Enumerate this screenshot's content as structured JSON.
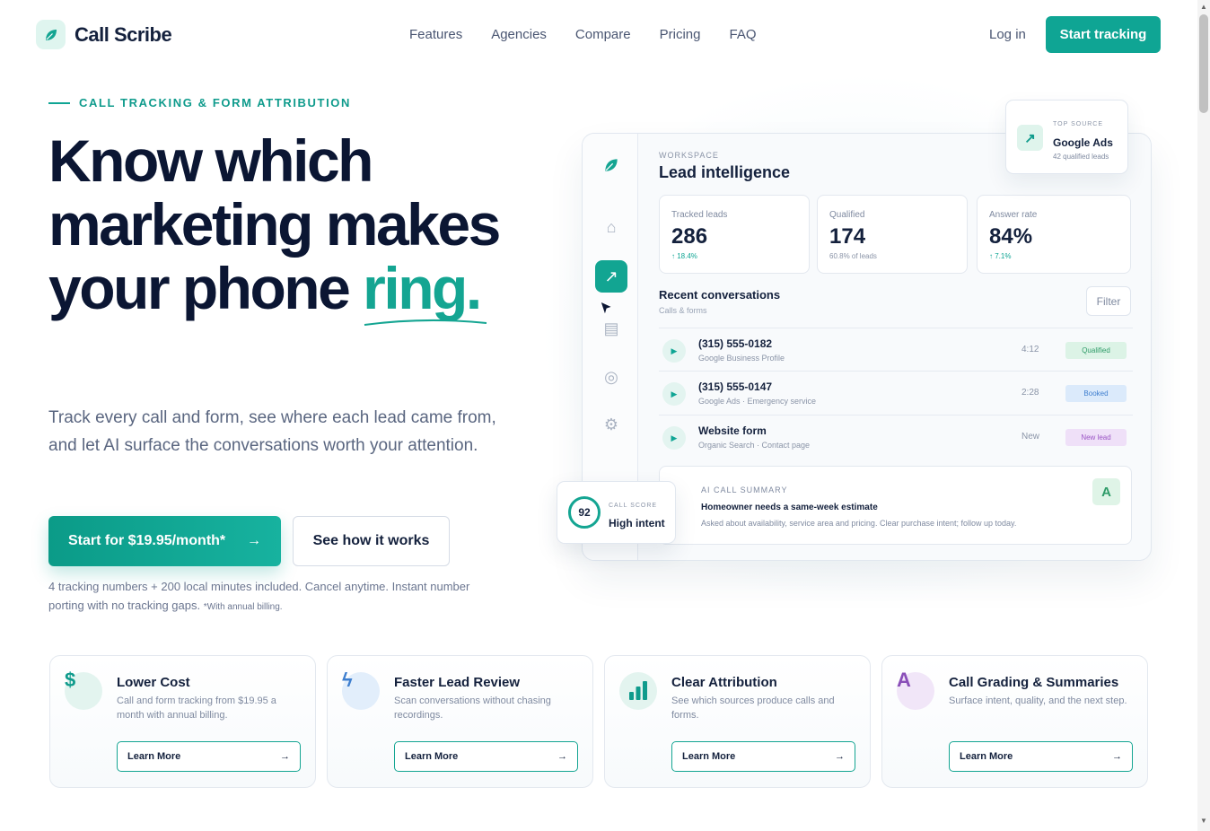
{
  "brand": {
    "name": "Call Scribe"
  },
  "nav": {
    "links": [
      "Features",
      "Agencies",
      "Compare",
      "Pricing",
      "FAQ"
    ],
    "login": "Log in",
    "cta": "Start tracking"
  },
  "hero": {
    "eyebrow": "CALL TRACKING & FORM ATTRIBUTION",
    "headline_main": "Know which marketing makes your phone ",
    "headline_accent": "ring.",
    "lede": "Track every call and form, see where each lead came from, and let AI surface the conversations worth your attention.",
    "primary_cta": "Start for $19.95/month*",
    "primary_arrow": "→",
    "secondary_cta": "See how it works",
    "fineprint": "4 tracking numbers + 200 local minutes included. Cancel anytime. Instant number porting with no tracking gaps.",
    "fineprint_small": "*With annual billing."
  },
  "dashboard": {
    "workspace_label": "WORKSPACE",
    "title": "Lead intelligence",
    "stats": [
      {
        "label": "Tracked leads",
        "value": "286",
        "sub": "↑ 18.4%"
      },
      {
        "label": "Qualified",
        "value": "174",
        "sub": "60.8% of leads"
      },
      {
        "label": "Answer rate",
        "value": "84%",
        "sub": "↑ 7.1%"
      }
    ],
    "conversations_title": "Recent conversations",
    "conversations_sub": "Calls & forms",
    "filter": "Filter",
    "rows": [
      {
        "title": "(315) 555-0182",
        "sub": "Google Business Profile",
        "dur": "4:12",
        "badge": "Qualified"
      },
      {
        "title": "(315) 555-0147",
        "sub": "Google Ads · Emergency service",
        "dur": "2:28",
        "badge": "Booked"
      },
      {
        "title": "Website form",
        "sub": "Organic Search · Contact page",
        "dur": "New",
        "badge": "New lead"
      }
    ],
    "ai_label": "AI CALL SUMMARY",
    "ai_title": "Homeowner needs a same-week estimate",
    "ai_sub": "Asked about availability, service area and pricing. Clear purchase intent; follow up today.",
    "ai_grade": "A"
  },
  "top_source": {
    "label": "TOP SOURCE",
    "title": "Google Ads",
    "sub": "42 qualified leads",
    "icon": "↗"
  },
  "call_score": {
    "value": "92",
    "label": "CALL SCORE",
    "text": "High intent"
  },
  "features": [
    {
      "icon": "$",
      "title": "Lower Cost",
      "text": "Call and form tracking from $19.95 a month with annual billing.",
      "button": "Learn More"
    },
    {
      "icon": "ϟ",
      "title": "Faster Lead Review",
      "text": "Scan conversations without chasing recordings.",
      "button": "Learn More"
    },
    {
      "icon": "bar-chart-icon",
      "title": "Clear Attribution",
      "text": "See which sources produce calls and forms.",
      "button": "Learn More"
    },
    {
      "icon": "A",
      "title": "Call Grading & Summaries",
      "text": "Surface intent, quality, and the next step.",
      "button": "Learn More"
    }
  ],
  "arrow": "→",
  "colors": {
    "accent": "#0fa594",
    "navy": "#0b1633"
  }
}
